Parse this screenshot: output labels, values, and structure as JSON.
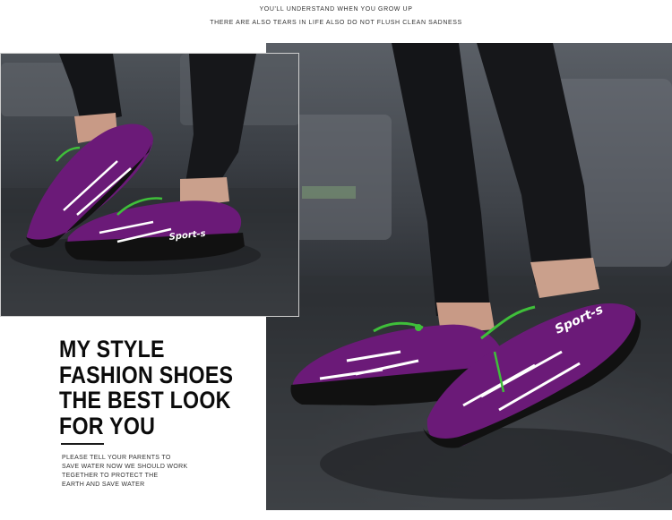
{
  "header": {
    "tagline_1": "YOU'LL UNDERSTAND WHEN YOU GROW UP",
    "tagline_2": "THERE ARE ALSO TEARS IN LIFE ALSO DO NOT FLUSH CLEAN SADNESS"
  },
  "headline": {
    "lines": [
      "MY STYLE",
      "FASHION SHOES",
      "THE BEST LOOK",
      "FOR YOU"
    ]
  },
  "body": {
    "lines": [
      "PLEASE TELL YOUR PARENTS TO",
      "SAVE WATER NOW WE SHOULD WORK",
      "TEGETHER TO PROTECT THE",
      "EARTH AND SAVE WATER"
    ]
  },
  "shoe": {
    "brand_mark": "Sport-s"
  },
  "colors": {
    "shoe_purple": "#6b1a78",
    "lace_green": "#3fbf3a",
    "sole_black": "#111111"
  }
}
